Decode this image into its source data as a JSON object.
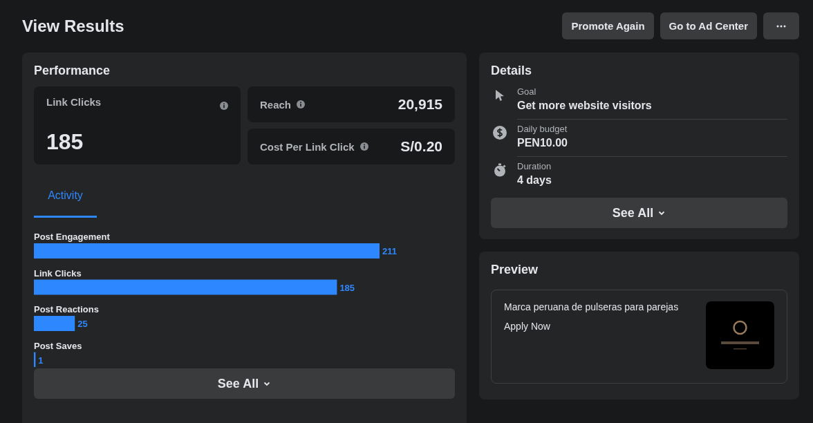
{
  "header": {
    "title": "View Results",
    "buttons": [
      "Promote Again",
      "Go to Ad Center"
    ]
  },
  "performance": {
    "title": "Performance",
    "primary_metric": {
      "label": "Link Clicks",
      "value": "185"
    },
    "metrics": [
      {
        "label": "Reach",
        "value": "20,915"
      },
      {
        "label": "Cost Per Link Click",
        "value": "S/0.20"
      }
    ],
    "tabs": [
      {
        "label": "Activity",
        "selected": true
      }
    ],
    "chart_data": {
      "type": "bar",
      "orientation": "horizontal",
      "categories": [
        "Post Engagement",
        "Link Clicks",
        "Post Reactions",
        "Post Saves"
      ],
      "values": [
        211,
        185,
        25,
        1
      ],
      "xlim": [
        0,
        211
      ],
      "data_labels": true
    },
    "see_all": "See All"
  },
  "details": {
    "title": "Details",
    "items": [
      {
        "kind": "goal",
        "label": "Goal",
        "value": "Get more website visitors"
      },
      {
        "kind": "budget",
        "label": "Daily budget",
        "value": "PEN10.00"
      },
      {
        "kind": "duration",
        "label": "Duration",
        "value": "4 days"
      }
    ],
    "see_all": "See All"
  },
  "preview": {
    "title": "Preview",
    "text": "Marca peruana de pulseras para parejas",
    "cta": "Apply Now"
  }
}
